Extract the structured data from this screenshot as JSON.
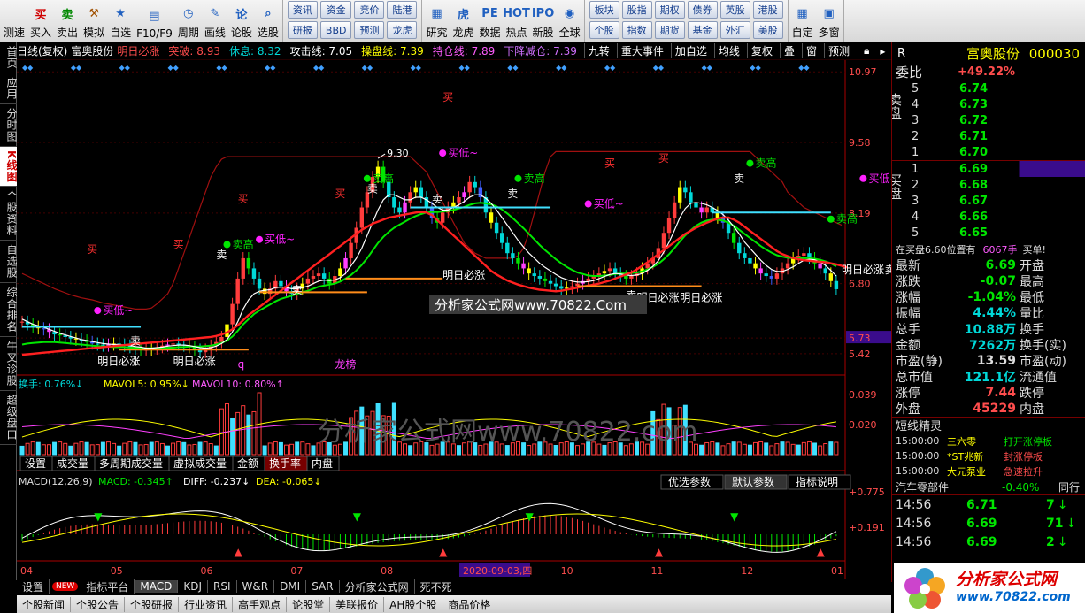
{
  "toolbar": {
    "items": [
      {
        "label": "测速",
        "icon": "speed-icon",
        "color": "#2a7ad8"
      },
      {
        "label": "买入",
        "icon": "buy-icon",
        "glyph": "买",
        "color": "#d00000"
      },
      {
        "label": "卖出",
        "icon": "sell-icon",
        "glyph": "卖",
        "color": "#008800"
      },
      {
        "label": "模拟",
        "icon": "hammer-icon",
        "glyph": "⚒",
        "color": "#a05000"
      },
      {
        "label": "自选",
        "icon": "star-icon",
        "glyph": "★",
        "color": "#2060c0"
      },
      {
        "label": "F10/F9",
        "icon": "f10-icon",
        "glyph": "▤",
        "color": "#2060c0"
      },
      {
        "label": "周期",
        "icon": "clock-icon",
        "glyph": "◷",
        "color": "#2060c0"
      },
      {
        "label": "画线",
        "icon": "pen-icon",
        "glyph": "✎",
        "color": "#2060c0"
      },
      {
        "label": "论股",
        "icon": "discuss-icon",
        "glyph": "论",
        "color": "#2060c0"
      },
      {
        "label": "选股",
        "icon": "magnifier-icon",
        "glyph": "⌕",
        "color": "#2060c0"
      }
    ],
    "grid1": [
      "资讯",
      "资金",
      "竞价",
      "陆港",
      "研报",
      "BBD",
      "预测",
      "龙虎"
    ],
    "mid": [
      {
        "label": "研究",
        "icon": "chart-icon",
        "glyph": "▦"
      },
      {
        "label": "龙虎",
        "icon": "dragon-icon",
        "glyph": "虎"
      },
      {
        "label": "数据",
        "icon": "pe-icon",
        "glyph": "PE"
      },
      {
        "label": "热点",
        "icon": "hot-icon",
        "glyph": "HOT"
      },
      {
        "label": "新股",
        "icon": "ipo-icon",
        "glyph": "IPO"
      },
      {
        "label": "全球",
        "icon": "globe-icon",
        "glyph": "◉"
      }
    ],
    "grid2": [
      "板块",
      "股指",
      "期权",
      "债券",
      "英股",
      "港股",
      "个股",
      "指数",
      "期货",
      "基金",
      "外汇",
      "美股"
    ],
    "right": [
      {
        "label": "自定",
        "icon": "custom-icon",
        "glyph": "▦"
      },
      {
        "label": "多窗",
        "icon": "window-icon",
        "glyph": "▣"
      }
    ]
  },
  "lefttabs": [
    "首页",
    "应用",
    "分时图",
    "K线图",
    "个股资料",
    "自选股",
    "综合排名",
    "牛叉诊股",
    "超级盘口"
  ],
  "chart": {
    "header": [
      "日线(复权)",
      "富奥股份"
    ],
    "indicators": [
      {
        "text": "明日必涨",
        "color": "#ff4d4d"
      },
      {
        "text": "突破: 8.93",
        "color": "#ff4d4d"
      },
      {
        "text": "休息: 8.32",
        "color": "#00d8d8"
      },
      {
        "text": "攻击线: 7.05",
        "color": "#ffffff"
      },
      {
        "text": "操盘线: 7.39",
        "color": "#ffff00"
      },
      {
        "text": "持仓线: 7.89",
        "color": "#ff5cff"
      },
      {
        "text": "下降减仓: 7.39",
        "color": "#d070ff"
      }
    ],
    "buttons": [
      "九转",
      "重大事件",
      "加自选",
      "均线",
      "复权",
      "叠",
      "窗",
      "预测"
    ],
    "yticks": [
      "10.97",
      "9.58",
      "8.19",
      "6.80",
      "5.73",
      "5.42"
    ],
    "vol_ticks": [
      "0.039",
      "0.020"
    ],
    "macd_ticks": [
      "+0.775",
      "+0.191"
    ],
    "xticks": [
      "04",
      "05",
      "06",
      "07",
      "08",
      "09",
      "10",
      "11",
      "12",
      "01"
    ],
    "cursor_date": "2020-09-03,四",
    "high_label": "9.30",
    "vol_header": [
      {
        "text": "换手: 0.76%↓",
        "color": "#00d8d8"
      },
      {
        "text": "MAVOL5: 0.95%↓",
        "color": "#ffff00"
      },
      {
        "text": "MAVOL10: 0.80%↑",
        "color": "#ff5cff"
      }
    ],
    "vol_tabs": [
      "设置",
      "成交量",
      "多周期成交量",
      "虚拟成交量",
      "金额",
      "换手率",
      "内盘"
    ],
    "vol_active": "换手率",
    "macd_header": [
      {
        "text": "MACD(12,26,9)",
        "color": "#dddddd"
      },
      {
        "text": "MACD: -0.345↑",
        "color": "#00e600"
      },
      {
        "text": "DIFF: -0.237↓",
        "color": "#ffffff"
      },
      {
        "text": "DEA: -0.065↓",
        "color": "#ffff00"
      }
    ],
    "macd_buttons": [
      "优选参数",
      "默认参数",
      "指标说明"
    ],
    "watermark1": "分析家公式网www.70822.Com",
    "watermark2": "分析家公式网www.70822.com",
    "labels": {
      "mingri": "明日必涨",
      "maigao": "卖高",
      "maidi": "买低~",
      "mai": "买",
      "mai_sell": "卖",
      "bang": "龙榜",
      "q": "q"
    }
  },
  "quote": {
    "name": "富奥股份",
    "code": "000030",
    "r": "R",
    "weibi_label": "委比",
    "weibi": "+49.22%",
    "sell_label": "卖盘",
    "buy_label": "买盘",
    "asks": [
      {
        "lvl": "5",
        "price": "6.74"
      },
      {
        "lvl": "4",
        "price": "6.73"
      },
      {
        "lvl": "3",
        "price": "6.72"
      },
      {
        "lvl": "2",
        "price": "6.71"
      },
      {
        "lvl": "1",
        "price": "6.70"
      }
    ],
    "bids": [
      {
        "lvl": "1",
        "price": "6.69"
      },
      {
        "lvl": "2",
        "price": "6.68"
      },
      {
        "lvl": "3",
        "price": "6.67"
      },
      {
        "lvl": "4",
        "price": "6.66"
      },
      {
        "lvl": "5",
        "price": "6.65"
      }
    ],
    "notice": "在买盘6.60位置有",
    "notice_qty": "6067手",
    "notice_tag": "买单!",
    "stats": [
      {
        "l1": "最新",
        "v1": "6.69",
        "c1": "grn",
        "l2": "开盘",
        "v2": ""
      },
      {
        "l1": "涨跌",
        "v1": "-0.07",
        "c1": "grn",
        "l2": "最高",
        "v2": ""
      },
      {
        "l1": "涨幅",
        "v1": "-1.04%",
        "c1": "grn",
        "l2": "最低",
        "v2": ""
      },
      {
        "l1": "振幅",
        "v1": "4.44%",
        "c1": "cyn",
        "l2": "量比",
        "v2": ""
      },
      {
        "l1": "总手",
        "v1": "10.88万",
        "c1": "cyn",
        "l2": "换手",
        "v2": ""
      },
      {
        "l1": "金额",
        "v1": "7262万",
        "c1": "cyn",
        "l2": "换手(实)",
        "v2": ""
      },
      {
        "l1": "市盈(静)",
        "v1": "13.59",
        "c1": "wht",
        "l2": "市盈(动)",
        "v2": ""
      },
      {
        "l1": "总市值",
        "v1": "121.1亿",
        "c1": "cyn",
        "l2": "流通值",
        "v2": ""
      },
      {
        "l1": "涨停",
        "v1": "7.44",
        "c1": "red",
        "l2": "跌停",
        "v2": ""
      },
      {
        "l1": "外盘",
        "v1": "45229",
        "c1": "red",
        "l2": "内盘",
        "v2": ""
      }
    ],
    "elf_title": "短线精灵",
    "elf": [
      {
        "time": "15:00:00",
        "name": "三六零",
        "msg": "打开涨停板",
        "c": "grn"
      },
      {
        "time": "15:00:00",
        "name": "*ST兆新",
        "msg": "封涨停板",
        "c": "red"
      },
      {
        "time": "15:00:00",
        "name": "大元泵业",
        "msg": "急速拉升",
        "c": "red"
      }
    ],
    "sector": "汽车零部件",
    "sector_pct": "-0.40%",
    "sector_more": "同行",
    "ticks": [
      {
        "time": "14:56",
        "price": "6.71",
        "vol": "7"
      },
      {
        "time": "14:56",
        "price": "6.69",
        "vol": "71"
      },
      {
        "time": "14:56",
        "price": "6.69",
        "vol": "2"
      }
    ]
  },
  "bottomtabs": [
    "设置",
    "NEW",
    "指标平台",
    "MACD",
    "KDJ",
    "RSI",
    "W&R",
    "DMI",
    "SAR",
    "分析家公式网",
    "死不死"
  ],
  "bottom_active": "MACD",
  "bottomtabs2": [
    "个股新闻",
    "个股公告",
    "个股研报",
    "行业资讯",
    "高手观点",
    "论股堂",
    "美联报价",
    "AH股个股",
    "商品价格"
  ],
  "logo": {
    "text": "分析家公式网",
    "url": "www.70822.com"
  },
  "series": {
    "close": [
      6.05,
      6.0,
      5.95,
      5.92,
      5.9,
      5.85,
      5.8,
      5.78,
      5.75,
      5.72,
      5.7,
      5.68,
      5.65,
      5.62,
      5.6,
      5.58,
      5.6,
      5.62,
      5.6,
      5.58,
      5.55,
      5.52,
      5.5,
      5.5,
      5.52,
      5.55,
      5.58,
      5.6,
      5.62,
      5.6,
      5.58,
      5.55,
      5.5,
      5.45,
      5.5,
      5.58,
      5.65,
      5.75,
      6.0,
      6.4,
      6.9,
      7.3,
      7.1,
      6.9,
      6.7,
      6.6,
      6.7,
      6.85,
      6.75,
      6.65,
      6.6,
      6.7,
      6.8,
      6.9,
      6.95,
      7.0,
      6.9,
      6.8,
      6.95,
      7.1,
      7.3,
      7.6,
      7.9,
      8.3,
      8.6,
      8.9,
      9.1,
      8.8,
      8.5,
      8.3,
      8.2,
      8.4,
      8.6,
      8.7,
      8.5,
      8.3,
      8.1,
      8.0,
      8.2,
      8.3,
      8.4,
      8.5,
      8.6,
      8.8,
      8.7,
      8.5,
      8.2,
      8.0,
      7.8,
      7.6,
      7.4,
      7.3,
      7.2,
      7.1,
      7.0,
      6.95,
      6.9,
      6.85,
      6.8,
      6.75,
      6.7,
      6.72,
      6.75,
      6.8,
      6.85,
      6.9,
      6.95,
      7.0,
      7.05,
      7.1,
      7.0,
      6.95,
      6.9,
      6.95,
      7.0,
      7.1,
      7.2,
      7.3,
      7.5,
      7.8,
      8.1,
      8.4,
      8.7,
      8.6,
      8.4,
      8.3,
      8.2,
      8.3,
      8.2,
      8.1,
      8.0,
      7.8,
      7.6,
      7.4,
      7.3,
      7.2,
      7.1,
      7.0,
      6.95,
      6.9,
      7.0,
      7.1,
      7.2,
      7.3,
      7.35,
      7.4,
      7.3,
      7.2,
      7.1,
      7.0,
      6.85,
      6.69
    ],
    "ma_short": [
      6.1,
      6.05,
      6.0,
      5.97,
      5.94,
      5.9,
      5.86,
      5.82,
      5.79,
      5.76,
      5.73,
      5.7,
      5.68,
      5.66,
      5.64,
      5.62,
      5.61,
      5.6,
      5.6,
      5.59,
      5.58,
      5.56,
      5.55,
      5.53,
      5.53,
      5.54,
      5.55,
      5.57,
      5.58,
      5.59,
      5.59,
      5.58,
      5.56,
      5.54,
      5.53,
      5.54,
      5.57,
      5.62,
      5.7,
      5.85,
      6.05,
      6.3,
      6.48,
      6.6,
      6.65,
      6.67,
      6.68,
      6.72,
      6.73,
      6.72,
      6.7,
      6.7,
      6.72,
      6.75,
      6.8,
      6.85,
      6.87,
      6.86,
      6.87,
      6.92,
      7.0,
      7.15,
      7.3,
      7.5,
      7.75,
      8.0,
      8.25,
      8.45,
      8.55,
      8.55,
      8.5,
      8.45,
      8.45,
      8.5,
      8.5,
      8.45,
      8.38,
      8.3,
      8.25,
      8.25,
      8.3,
      8.35,
      8.42,
      8.5,
      8.55,
      8.55,
      8.48,
      8.38,
      8.25,
      8.1,
      7.95,
      7.8,
      7.65,
      7.52,
      7.4,
      7.3,
      7.2,
      7.12,
      7.05,
      6.98,
      6.92,
      6.88,
      6.85,
      6.83,
      6.83,
      6.84,
      6.86,
      6.9,
      6.94,
      6.98,
      7.0,
      6.99,
      6.97,
      6.96,
      6.97,
      7.0,
      7.06,
      7.14,
      7.25,
      7.42,
      7.62,
      7.85,
      8.1,
      8.28,
      8.38,
      8.4,
      8.38,
      8.35,
      8.3,
      8.24,
      8.16,
      8.05,
      7.92,
      7.78,
      7.62,
      7.5,
      7.38,
      7.26,
      7.16,
      7.08,
      7.04,
      7.04,
      7.08,
      7.13,
      7.2,
      7.26,
      7.28,
      7.27,
      7.23,
      7.16,
      7.06,
      6.95
    ],
    "ma_mid": [
      5.6,
      5.62,
      5.63,
      5.64,
      5.65,
      5.65,
      5.65,
      5.64,
      5.63,
      5.62,
      5.61,
      5.6,
      5.59,
      5.58,
      5.57,
      5.56,
      5.56,
      5.55,
      5.55,
      5.55,
      5.54,
      5.54,
      5.53,
      5.53,
      5.53,
      5.53,
      5.53,
      5.54,
      5.54,
      5.55,
      5.55,
      5.56,
      5.56,
      5.56,
      5.57,
      5.58,
      5.6,
      5.63,
      5.68,
      5.76,
      5.87,
      6.0,
      6.1,
      6.2,
      6.27,
      6.33,
      6.39,
      6.45,
      6.5,
      6.53,
      6.56,
      6.6,
      6.63,
      6.66,
      6.7,
      6.74,
      6.76,
      6.78,
      6.8,
      6.84,
      6.9,
      6.97,
      7.06,
      7.17,
      7.3,
      7.45,
      7.6,
      7.72,
      7.82,
      7.9,
      7.96,
      8.02,
      8.08,
      8.13,
      8.17,
      8.2,
      8.21,
      8.21,
      8.22,
      8.23,
      8.25,
      8.28,
      8.31,
      8.35,
      8.38,
      8.39,
      8.38,
      8.36,
      8.32,
      8.26,
      8.18,
      8.09,
      7.99,
      7.89,
      7.78,
      7.67,
      7.56,
      7.46,
      7.37,
      7.28,
      7.2,
      7.13,
      7.07,
      7.02,
      6.99,
      6.96,
      6.95,
      6.95,
      6.96,
      6.97,
      6.99,
      7.0,
      7.0,
      7.01,
      7.02,
      7.04,
      7.08,
      7.13,
      7.19,
      7.28,
      7.38,
      7.5,
      7.63,
      7.75,
      7.85,
      7.94,
      8.0,
      8.04,
      8.06,
      8.06,
      8.04,
      8.0,
      7.94,
      7.86,
      7.78,
      7.7,
      7.62,
      7.54,
      7.47,
      7.41,
      7.36,
      7.33,
      7.31,
      7.3,
      7.3,
      7.3,
      7.3,
      7.29,
      7.27,
      7.24,
      7.2,
      7.14
    ],
    "red_line": [
      5.4,
      5.41,
      5.42,
      5.43,
      5.44,
      5.45,
      5.46,
      5.47,
      5.48,
      5.49,
      5.5,
      5.51,
      5.52,
      5.53,
      5.54,
      5.55,
      5.56,
      5.57,
      5.58,
      5.59,
      5.6,
      5.61,
      5.62,
      5.63,
      5.64,
      5.65,
      5.66,
      5.67,
      5.68,
      5.69,
      5.7,
      5.71,
      5.72,
      5.73,
      5.74,
      5.75,
      5.77,
      5.8,
      5.84,
      5.9,
      5.98,
      6.08,
      6.18,
      6.26,
      6.34,
      6.42,
      6.5,
      6.58,
      6.66,
      6.74,
      6.82,
      6.9,
      6.98,
      7.06,
      7.14,
      7.22,
      7.3,
      7.38,
      7.46,
      7.54,
      7.62,
      7.7,
      7.78,
      7.86,
      7.92,
      7.98,
      8.02,
      8.06,
      8.1,
      8.12,
      8.14,
      8.16,
      8.18,
      8.2,
      8.21,
      8.2,
      8.15,
      8.05,
      7.95,
      7.85,
      7.75,
      7.65,
      7.55,
      7.45,
      7.35,
      7.25,
      7.15,
      7.05,
      6.98,
      6.92,
      6.86,
      6.82,
      6.78,
      6.75,
      6.72,
      6.7,
      6.68,
      6.67,
      6.66,
      6.65,
      6.66,
      6.68,
      6.7,
      6.72,
      6.74,
      6.76,
      6.78,
      6.8,
      6.83,
      6.86,
      6.9,
      6.94,
      6.98,
      7.02,
      7.08,
      7.15,
      7.22,
      7.3,
      7.38,
      7.46,
      7.54,
      7.62,
      7.7,
      7.78,
      7.84,
      7.9,
      7.95,
      8.0,
      8.04,
      8.08,
      8.1,
      8.1,
      8.06,
      8.0,
      7.92,
      7.84,
      7.76,
      7.68,
      7.6,
      7.52,
      7.44,
      7.38,
      7.34,
      7.3,
      7.28,
      7.26,
      7.25,
      7.24,
      7.23,
      7.22,
      7.2,
      7.18,
      7.15,
      7.12
    ],
    "pressure": [
      7.0,
      6.95,
      6.9,
      6.85,
      6.8,
      6.75,
      6.7,
      6.66,
      6.62,
      6.58,
      6.55,
      6.52,
      6.5,
      6.48,
      6.45,
      6.42,
      6.4,
      6.38,
      6.36,
      6.34,
      6.32,
      6.3,
      6.3,
      6.3,
      6.32,
      6.4,
      6.5,
      6.6,
      6.8,
      7.1,
      7.4,
      7.7,
      8.0,
      8.3,
      8.6,
      8.9,
      9.1,
      9.25,
      9.3,
      9.3,
      9.3,
      9.3,
      9.3,
      9.3,
      9.3,
      9.3,
      9.3,
      9.3,
      9.3,
      9.3,
      9.3,
      9.3,
      9.3,
      9.3,
      9.3,
      9.3,
      9.3,
      9.3,
      9.3,
      9.3,
      9.3,
      9.3,
      9.3,
      9.3,
      9.3,
      9.3,
      9.3,
      9.3,
      9.3,
      9.3,
      9.3,
      9.3,
      9.3,
      9.2,
      9.1,
      9.0,
      8.8,
      8.6,
      8.4,
      8.2,
      8.0,
      7.8,
      7.6,
      7.5,
      7.4,
      7.35,
      7.3,
      7.3,
      7.3,
      7.3,
      7.3,
      7.3,
      7.35,
      7.5,
      7.8,
      8.2,
      8.6,
      9.0,
      9.3,
      9.4,
      9.4,
      9.4,
      9.4,
      9.4,
      9.4,
      9.4,
      9.4,
      9.4,
      9.4,
      9.4,
      9.4,
      9.4,
      9.4,
      9.4,
      9.4,
      9.4,
      9.4,
      9.4,
      9.4,
      9.4,
      9.4,
      9.4,
      9.4,
      9.4,
      9.4,
      9.4,
      9.4,
      9.4,
      9.4,
      9.4,
      9.4,
      9.4,
      9.4,
      9.4,
      9.4,
      9.4,
      9.3,
      9.2,
      9.1,
      9.0,
      8.9,
      8.8,
      8.6,
      8.5,
      8.4,
      8.3,
      8.25,
      8.2,
      8.15,
      8.1,
      8.05,
      8.0,
      7.95
    ]
  }
}
